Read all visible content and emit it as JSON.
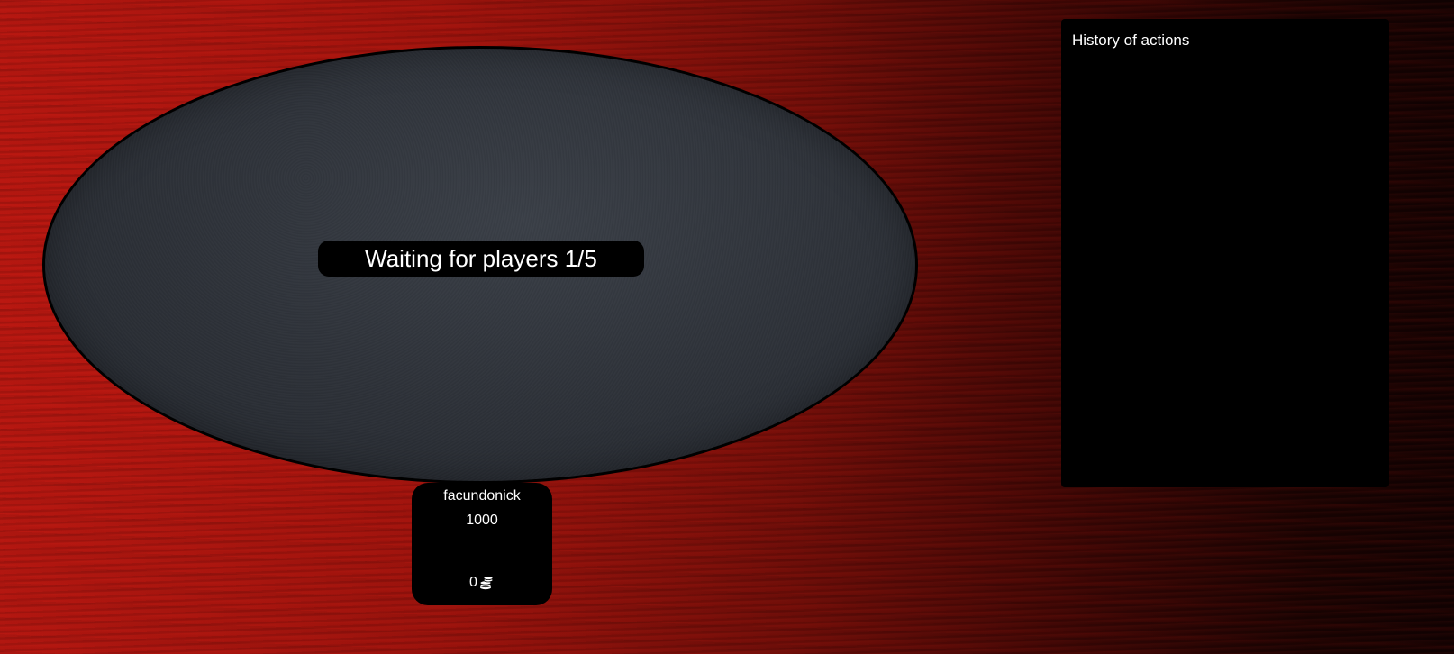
{
  "table": {
    "status_message": "Waiting for players 1/5"
  },
  "player": {
    "name": "facundonick",
    "stack": "1000",
    "bet": "0",
    "bet_icon": "coins-icon"
  },
  "history": {
    "title": "History of actions",
    "entries": []
  },
  "colors": {
    "background_accent": "#b31610",
    "table_felt": "#2c3037",
    "panel": "#000000",
    "text": "#ffffff"
  }
}
